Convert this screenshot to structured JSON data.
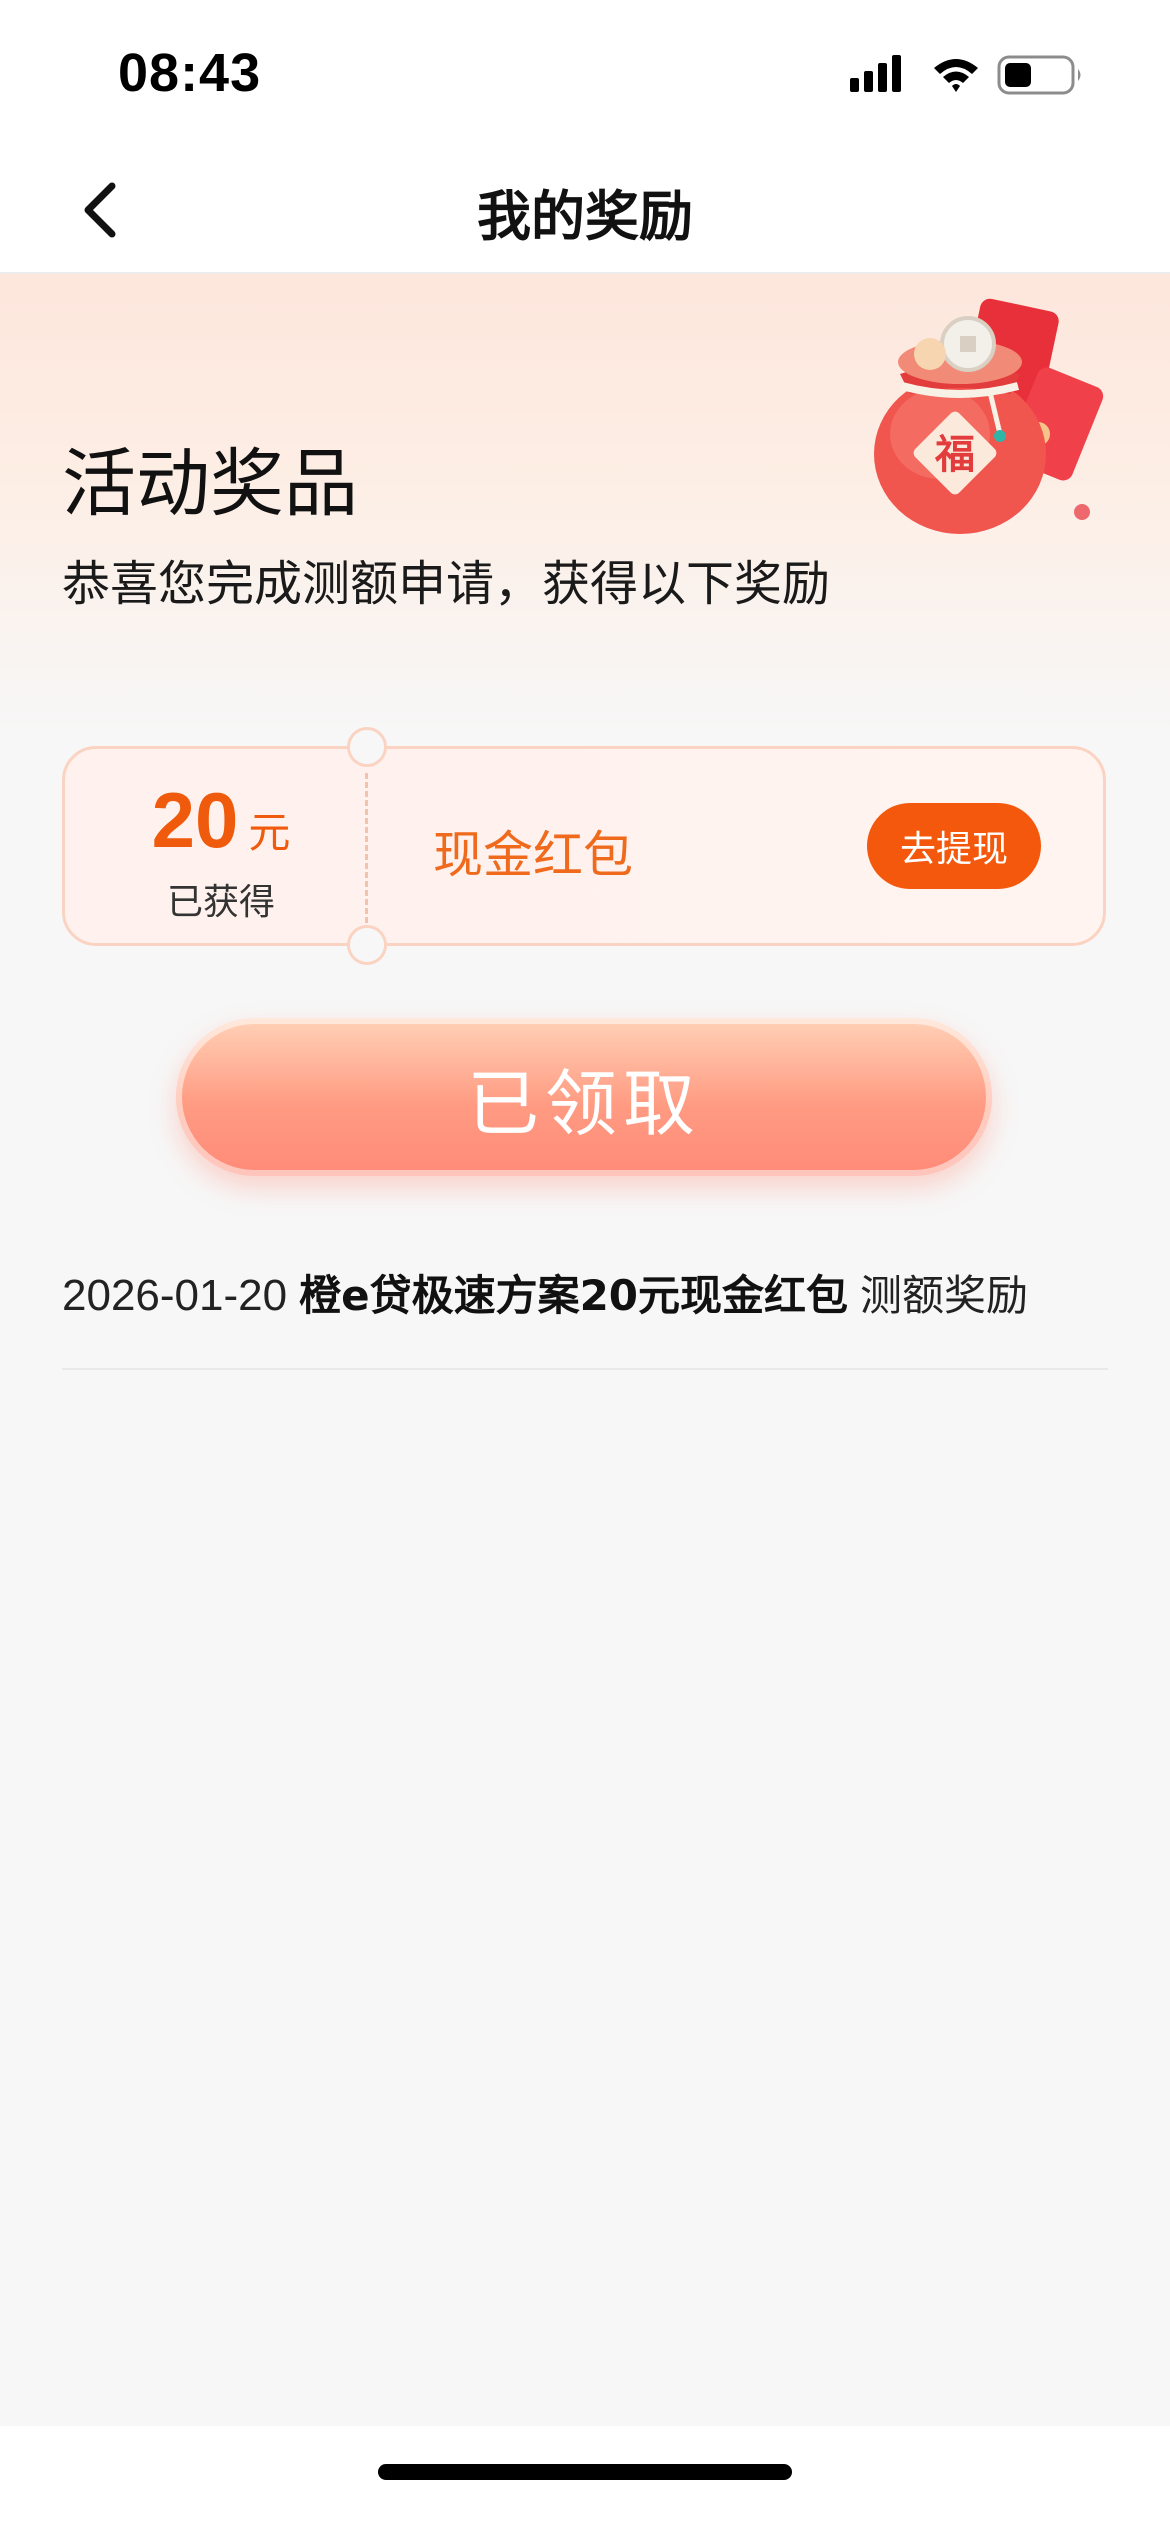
{
  "status_bar": {
    "time": "08:43"
  },
  "nav": {
    "title": "我的奖励"
  },
  "hero": {
    "title": "活动奖品",
    "subtitle": "恭喜您完成测额申请，获得以下奖励",
    "bag_character": "福"
  },
  "coupon": {
    "amount": "20",
    "unit": "元",
    "status": "已获得",
    "name": "现金红包",
    "action_label": "去提现"
  },
  "claim_button": {
    "label": "已领取"
  },
  "records": [
    {
      "date": "2026-01-20",
      "title": "橙e贷极速方案20元现金红包",
      "tag": "测额奖励"
    }
  ],
  "colors": {
    "accent": "#f3580c",
    "coupon_text": "#ef6a1d",
    "claimed_gradient_end": "#ff8a78"
  },
  "icons": {
    "back": "chevron-left-icon",
    "signal": "cellular-signal-icon",
    "wifi": "wifi-icon",
    "battery": "battery-icon"
  }
}
